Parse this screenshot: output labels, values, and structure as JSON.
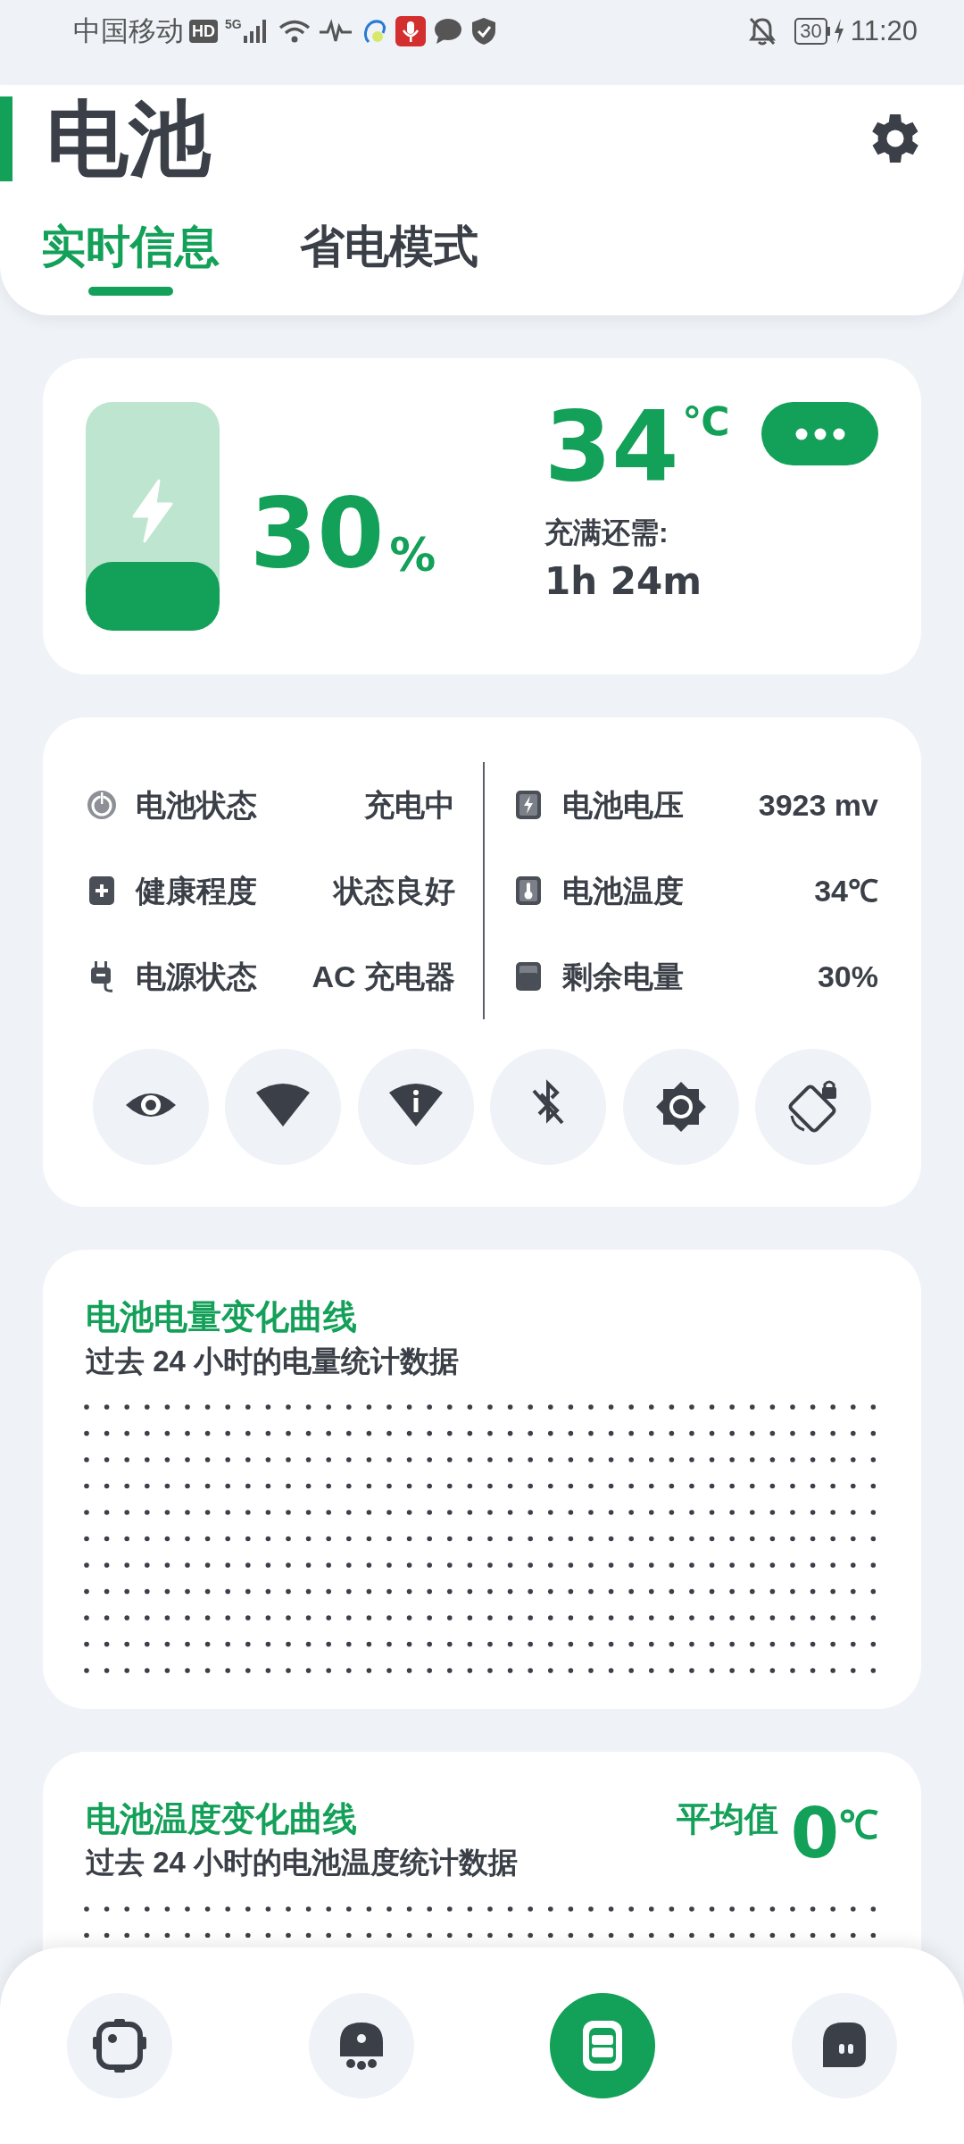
{
  "status_bar": {
    "carrier": "中国移动",
    "hd_badge": "HD",
    "network": "5G",
    "battery": "30",
    "time": "11:20"
  },
  "header": {
    "title": "电池",
    "tabs": [
      {
        "label": "实时信息",
        "selected": true
      },
      {
        "label": "省电模式",
        "selected": false
      }
    ]
  },
  "battery_card": {
    "level": 0.3,
    "percent": "30",
    "percent_unit": "%",
    "temperature": "34",
    "temperature_unit": "℃",
    "remaining_label": "充满还需:",
    "remaining": "1h 24m"
  },
  "info": {
    "left": [
      {
        "label": "电池状态",
        "value": "充电中"
      },
      {
        "label": "健康程度",
        "value": "状态良好"
      },
      {
        "label": "电源状态",
        "value": "AC 充电器"
      }
    ],
    "right": [
      {
        "label": "电池电压",
        "value": "3923 mv"
      },
      {
        "label": "电池温度",
        "value": "34℃"
      },
      {
        "label": "剩余电量",
        "value": "30%"
      }
    ]
  },
  "charts": [
    {
      "title": "电池电量变化曲线",
      "subtitle": "过去 24 小时的电量统计数据"
    },
    {
      "title": "电池温度变化曲线",
      "subtitle": "过去 24 小时的电池温度统计数据",
      "average_label": "平均值",
      "average_value": "0",
      "average_unit": "℃"
    }
  ],
  "bottom_nav": [
    {
      "selected": false
    },
    {
      "selected": false
    },
    {
      "selected": true
    },
    {
      "selected": false
    }
  ]
}
